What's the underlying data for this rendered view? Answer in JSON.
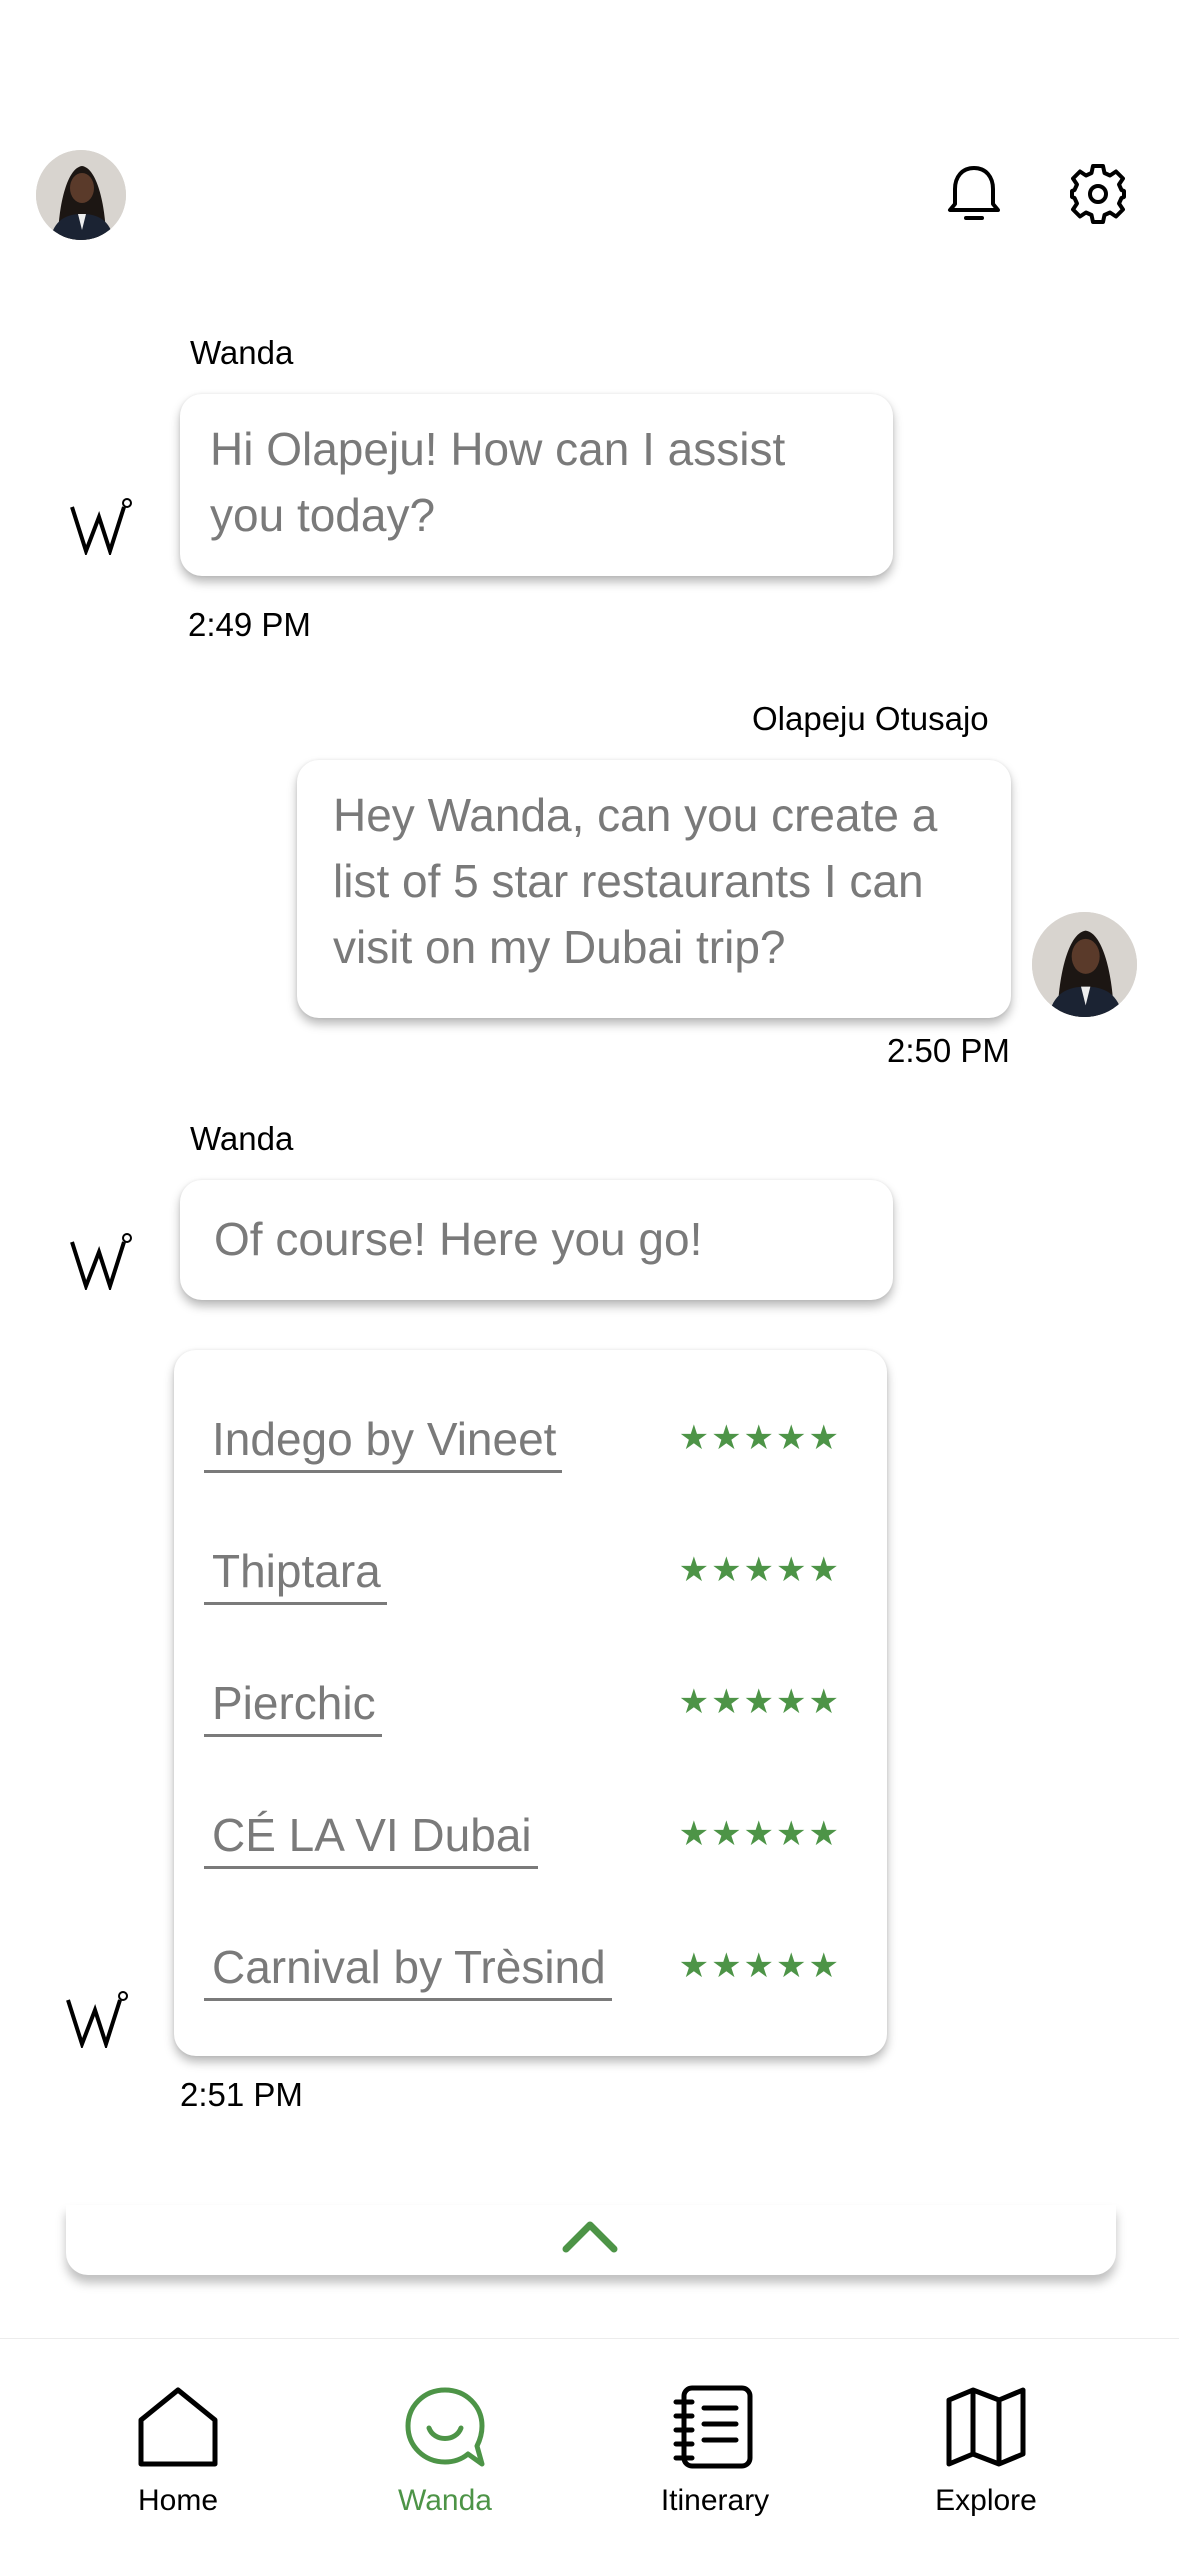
{
  "header": {
    "avatar_icon": "user-avatar",
    "notification_icon": "bell-icon",
    "settings_icon": "gear-icon"
  },
  "messages": [
    {
      "sender": "Wanda",
      "text": "Hi Olapeju! How can I assist you today?",
      "time": "2:49 PM"
    },
    {
      "sender": "Olapeju Otusajo",
      "text": "Hey Wanda, can you create a list of 5 star restaurants I can visit on my Dubai trip?",
      "time": "2:50 PM"
    },
    {
      "sender": "Wanda",
      "text": "Of course! Here you go!",
      "time": "2:51 PM"
    }
  ],
  "restaurants": [
    {
      "name": "Indego by Vineet",
      "rating": 5
    },
    {
      "name": "Thiptara",
      "rating": 5
    },
    {
      "name": "Pierchic",
      "rating": 5
    },
    {
      "name": "CÉ LA VI Dubai",
      "rating": 5
    },
    {
      "name": "Carnival by Trèsind",
      "rating": 5
    }
  ],
  "collapse": {
    "icon": "chevron-up-icon"
  },
  "nav": {
    "items": [
      {
        "label": "Home",
        "icon": "home-icon"
      },
      {
        "label": "Wanda",
        "icon": "chat-bubble-icon",
        "active": true
      },
      {
        "label": "Itinerary",
        "icon": "notebook-icon"
      },
      {
        "label": "Explore",
        "icon": "map-icon"
      }
    ]
  },
  "colors": {
    "accent": "#4d9447",
    "message_text": "#7a7a7a",
    "text": "#000000"
  }
}
